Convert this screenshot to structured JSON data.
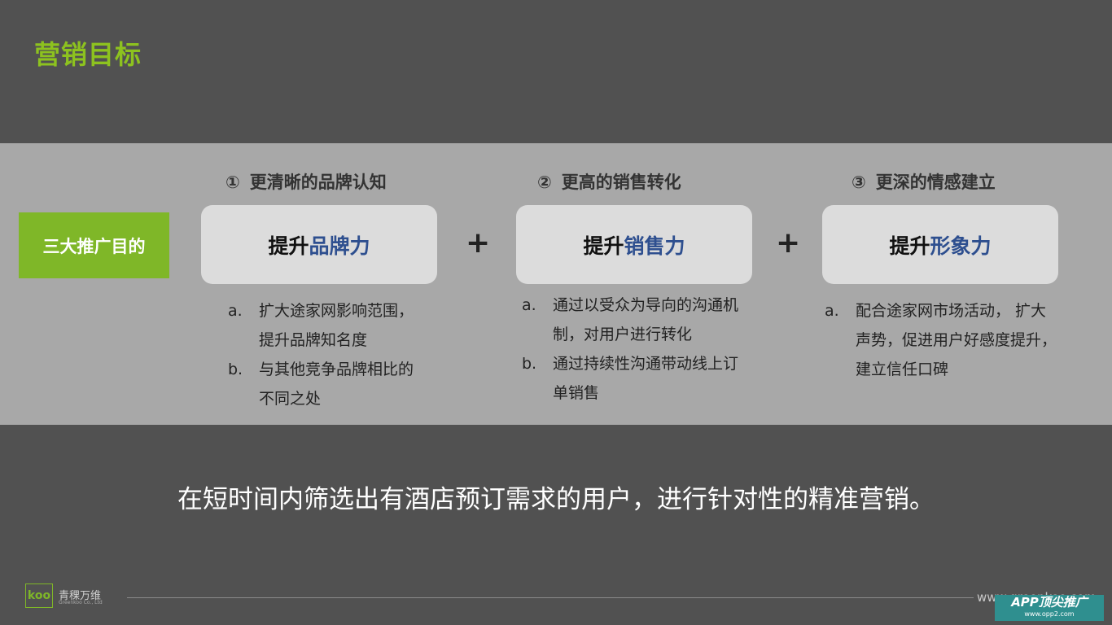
{
  "title": "营销目标",
  "goal_tag": "三大推广目的",
  "columns": [
    {
      "num": "①",
      "heading": "更清晰的品牌认知",
      "box_lead": "提升",
      "box_accent": "品牌力",
      "items": [
        {
          "marker": "a.",
          "text": "扩大途家网影响范围，提升品牌知名度"
        },
        {
          "marker": "b.",
          "text": "与其他竞争品牌相比的不同之处"
        }
      ]
    },
    {
      "num": "②",
      "heading": "更高的销售转化",
      "box_lead": "提升",
      "box_accent": "销售力",
      "items": [
        {
          "marker": "a.",
          "text": "通过以受众为导向的沟通机制，对用户进行转化"
        },
        {
          "marker": "b.",
          "text": "通过持续性沟通带动线上订单销售"
        }
      ]
    },
    {
      "num": "③",
      "heading": "更深的情感建立",
      "box_lead": "提升",
      "box_accent": "形象力",
      "items": [
        {
          "marker": "a.",
          "text": "配合途家网市场活动， 扩大声势，促进用户好感度提升，建立信任口碑"
        }
      ]
    }
  ],
  "plus_symbol": "+",
  "bottom_text": "在短时间内筛选出有酒店预订需求的用户，进行针对性的精准营销。",
  "footer": {
    "logo_mark": "koo",
    "logo_name": "青稞万维",
    "logo_sub": "Greenkoo Co., Ltd",
    "url": "www.greenkoo.com"
  },
  "watermark": {
    "line1": "APP顶尖推广",
    "line2": "www.opp2.com"
  }
}
